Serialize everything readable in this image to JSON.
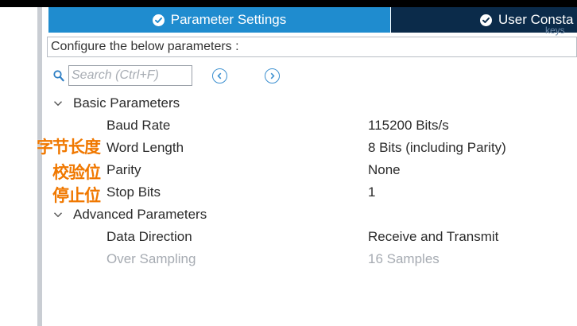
{
  "tabs": [
    {
      "label": "Parameter Settings",
      "state": "active",
      "icon": "check-circle-icon"
    },
    {
      "label": "User Consta",
      "state": "inactive",
      "icon": "check-circle-icon"
    }
  ],
  "tab_overflow_text": "keys",
  "header": {
    "configure_label": "Configure the below parameters :"
  },
  "search": {
    "placeholder": "Search (Ctrl+F)",
    "value": ""
  },
  "groups": {
    "basic": {
      "title": "Basic Parameters",
      "expanded": true,
      "items": [
        {
          "name": "Baud Rate",
          "value": "115200 Bits/s",
          "enabled": true
        },
        {
          "name": "Word Length",
          "value": "8 Bits (including Parity)",
          "enabled": true
        },
        {
          "name": "Parity",
          "value": "None",
          "enabled": true
        },
        {
          "name": "Stop Bits",
          "value": "1",
          "enabled": true
        }
      ]
    },
    "advanced": {
      "title": "Advanced Parameters",
      "expanded": true,
      "items": [
        {
          "name": "Data Direction",
          "value": "Receive and Transmit",
          "enabled": true
        },
        {
          "name": "Over Sampling",
          "value": "16 Samples",
          "enabled": false
        }
      ]
    }
  },
  "annotations": [
    "字节长度",
    "校验位",
    "停止位"
  ],
  "colors": {
    "tab_active": "#1f8ccf",
    "tab_inactive": "#0b2b4a",
    "annotation": "#f07800",
    "disabled_text": "#a6abb2",
    "nav_icon": "#3b8fd0"
  }
}
